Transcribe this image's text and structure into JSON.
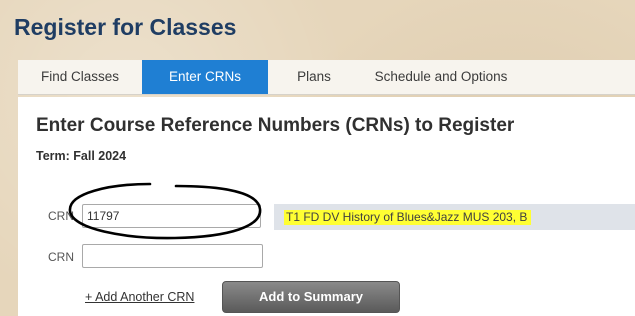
{
  "page": {
    "title": "Register for Classes"
  },
  "tabs": [
    {
      "label": "Find Classes",
      "active": false
    },
    {
      "label": "Enter CRNs",
      "active": true
    },
    {
      "label": "Plans",
      "active": false
    },
    {
      "label": "Schedule and Options",
      "active": false
    }
  ],
  "panel": {
    "heading": "Enter Course Reference Numbers (CRNs) to Register",
    "term": "Term: Fall 2024"
  },
  "crn_rows": [
    {
      "label": "CRN",
      "value": "11797",
      "result": "T1 FD DV History of Blues&Jazz MUS 203, B"
    },
    {
      "label": "CRN",
      "value": "",
      "result": ""
    }
  ],
  "actions": {
    "add_another_label": "+ Add Another CRN",
    "add_to_summary_label": "Add to Summary"
  },
  "colors": {
    "tab_active": "#1f7fd3",
    "title": "#1f3d63",
    "highlight": "#ffff33"
  }
}
